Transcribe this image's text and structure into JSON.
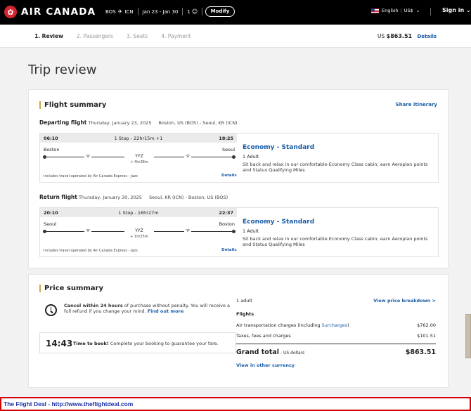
{
  "header": {
    "brand": "AIR CANADA",
    "origin": "BOS",
    "destination": "ICN",
    "dates": "Jan 23 - Jan 30",
    "passengers": "1",
    "modify_label": "Modify",
    "language": "English",
    "currency": "US$",
    "signin_label": "Sign in"
  },
  "steps": [
    {
      "label": "1. Review"
    },
    {
      "label": "2. Passengers"
    },
    {
      "label": "3. Seats"
    },
    {
      "label": "4. Payment"
    }
  ],
  "total_bar": {
    "prefix": "US",
    "amount": "$863.51",
    "details_label": "Details"
  },
  "page_title": "Trip review",
  "flight_summary": {
    "title": "Flight summary",
    "share_label": "Share itinerary",
    "departing": {
      "label": "Departing flight",
      "date": "Thursday, January 23, 2025",
      "route": "Boston, US (BOS) - Seoul, KR (ICN)",
      "dep_time": "06:10",
      "stops": "1 Stop - 22hr15m +1",
      "arr_time": "18:25",
      "from_city": "Boston",
      "to_city": "Seoul",
      "stop_code": "YYZ",
      "layover": "+ 4hr38m",
      "operated": "Includes travel operated by Air Canada Express - Jazz.",
      "details_label": "Details",
      "cabin": "Economy - Standard",
      "adults": "1 Adult",
      "cabin_desc": "Sit back and relax in our comfortable Economy Class cabin; earn Aeroplan points and Status Qualifying Miles"
    },
    "return": {
      "label": "Return flight",
      "date": "Thursday, January 30, 2025",
      "route": "Seoul, KR (ICN) - Boston, US (BOS)",
      "dep_time": "20:10",
      "stops": "1 Stop - 16hr27m",
      "arr_time": "22:37",
      "from_city": "Seoul",
      "to_city": "Boston",
      "stop_code": "YYZ",
      "layover": "+ 1hr25m",
      "operated": "Includes travel operated by Air Canada Express - Jazz.",
      "details_label": "Details",
      "cabin": "Economy - Standard",
      "adults": "1 Adult",
      "cabin_desc": "Sit back and relax in our comfortable Economy Class cabin; earn Aeroplan points and Status Qualifying Miles"
    }
  },
  "price_summary": {
    "title": "Price summary",
    "cancel_bold": "Cancel within 24 hours",
    "cancel_rest": " of purchase without penalty. You will receive a full refund if you change your mind. ",
    "find_out_more": "Find out more",
    "timer": "14:43",
    "timer_bold": "Time to book!",
    "timer_text": " Complete your booking to guarantee your fare.",
    "adult_label": "1 adult",
    "view_breakdown": "View price breakdown >",
    "flights_heading": "Flights",
    "air_charges_label": "Air transportation charges (including ",
    "surcharges_link": "Surcharges",
    "air_charges_close": ")",
    "air_charges_value": "$762.00",
    "taxes_label": "Taxes, fees and charges",
    "taxes_value": "$101.51",
    "grand_total_label": "Grand total",
    "grand_total_currency": " - US dollars",
    "grand_total_value": "$863.51",
    "other_currency": "View in other currency"
  },
  "footer": {
    "text": "The Flight Deal - http://www.theflightdeal.com"
  },
  "colors": {
    "accent": "#c9a84c",
    "link": "#1a5ea8",
    "brand_red": "#d22630",
    "footer_border": "#d40000"
  }
}
